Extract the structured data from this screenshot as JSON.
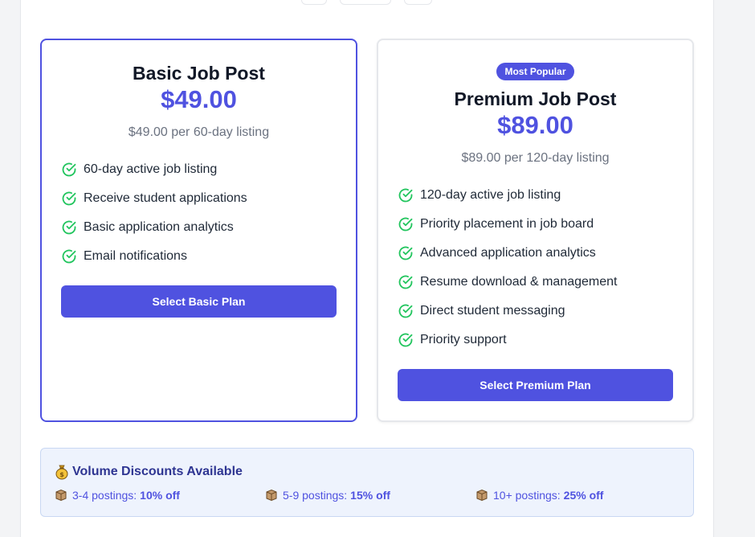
{
  "basic": {
    "title": "Basic Job Post",
    "price": "$49.00",
    "subtitle": "$49.00 per 60-day listing",
    "features": [
      "60-day active job listing",
      "Receive student applications",
      "Basic application analytics",
      "Email notifications"
    ],
    "cta": "Select Basic Plan"
  },
  "premium": {
    "badge": "Most Popular",
    "title": "Premium Job Post",
    "price": "$89.00",
    "subtitle": "$89.00 per 120-day listing",
    "features": [
      "120-day active job listing",
      "Priority placement in job board",
      "Advanced application analytics",
      "Resume download & management",
      "Direct student messaging",
      "Priority support"
    ],
    "cta": "Select Premium Plan"
  },
  "discounts": {
    "heading": "Volume Discounts Available",
    "items": [
      {
        "label": "3-4 postings:",
        "value": "10% off"
      },
      {
        "label": "5-9 postings:",
        "value": "15% off"
      },
      {
        "label": "10+ postings:",
        "value": "25% off"
      }
    ]
  },
  "colors": {
    "accent": "#4f52e0",
    "check": "#22c55e",
    "discount_bg": "#eef3fd"
  },
  "icons": {
    "feature": "check-circle-icon",
    "discount_heading": "money-bag-icon",
    "discount_item": "package-icon"
  }
}
